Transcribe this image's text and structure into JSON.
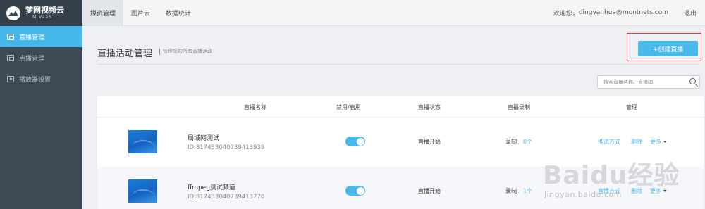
{
  "brand": {
    "title": "梦网视频云",
    "subtitle": "M VaaS"
  },
  "sidebar": {
    "items": [
      {
        "label": "直播管理",
        "icon": "live-grid-icon"
      },
      {
        "label": "点播管理",
        "icon": "vod-grid-icon"
      },
      {
        "label": "播放器设置",
        "icon": "player-play-icon"
      }
    ]
  },
  "topbar": {
    "tabs": [
      {
        "label": "媒资管理"
      },
      {
        "label": "图片云"
      },
      {
        "label": "数据统计"
      }
    ],
    "welcome": "欢迎您，",
    "user": "dingyanhua@montnets.com",
    "logout": "退出"
  },
  "page": {
    "title": "直播活动管理",
    "description": "管理您的所有直播活动",
    "create_button": "+创建直播"
  },
  "search": {
    "placeholder": "搜索直播名称、直播ID"
  },
  "table": {
    "headers": [
      "直播名称",
      "禁用/启用",
      "直播状态",
      "直播录制",
      "管理"
    ],
    "rows": [
      {
        "name": "局域网测试",
        "id": "ID:817433040739413939",
        "enabled": true,
        "status": "直播开始",
        "record_label": "录制",
        "record_count": "0个",
        "actions": [
          "推流方式",
          "删除",
          "更多"
        ]
      },
      {
        "name": "ffmpeg测试频道",
        "id": "ID:817433040739413770",
        "enabled": true,
        "status": "直播开始",
        "record_label": "录制",
        "record_count": "1个",
        "actions": [
          "直播方式",
          "删除",
          "更多"
        ]
      }
    ]
  },
  "watermark": {
    "main": "Baidu经验",
    "sub": "jingyan.baidu.com"
  },
  "colors": {
    "accent": "#4ab8e8",
    "sidebar": "#3e4a56",
    "highlight": "#e23c3c"
  }
}
